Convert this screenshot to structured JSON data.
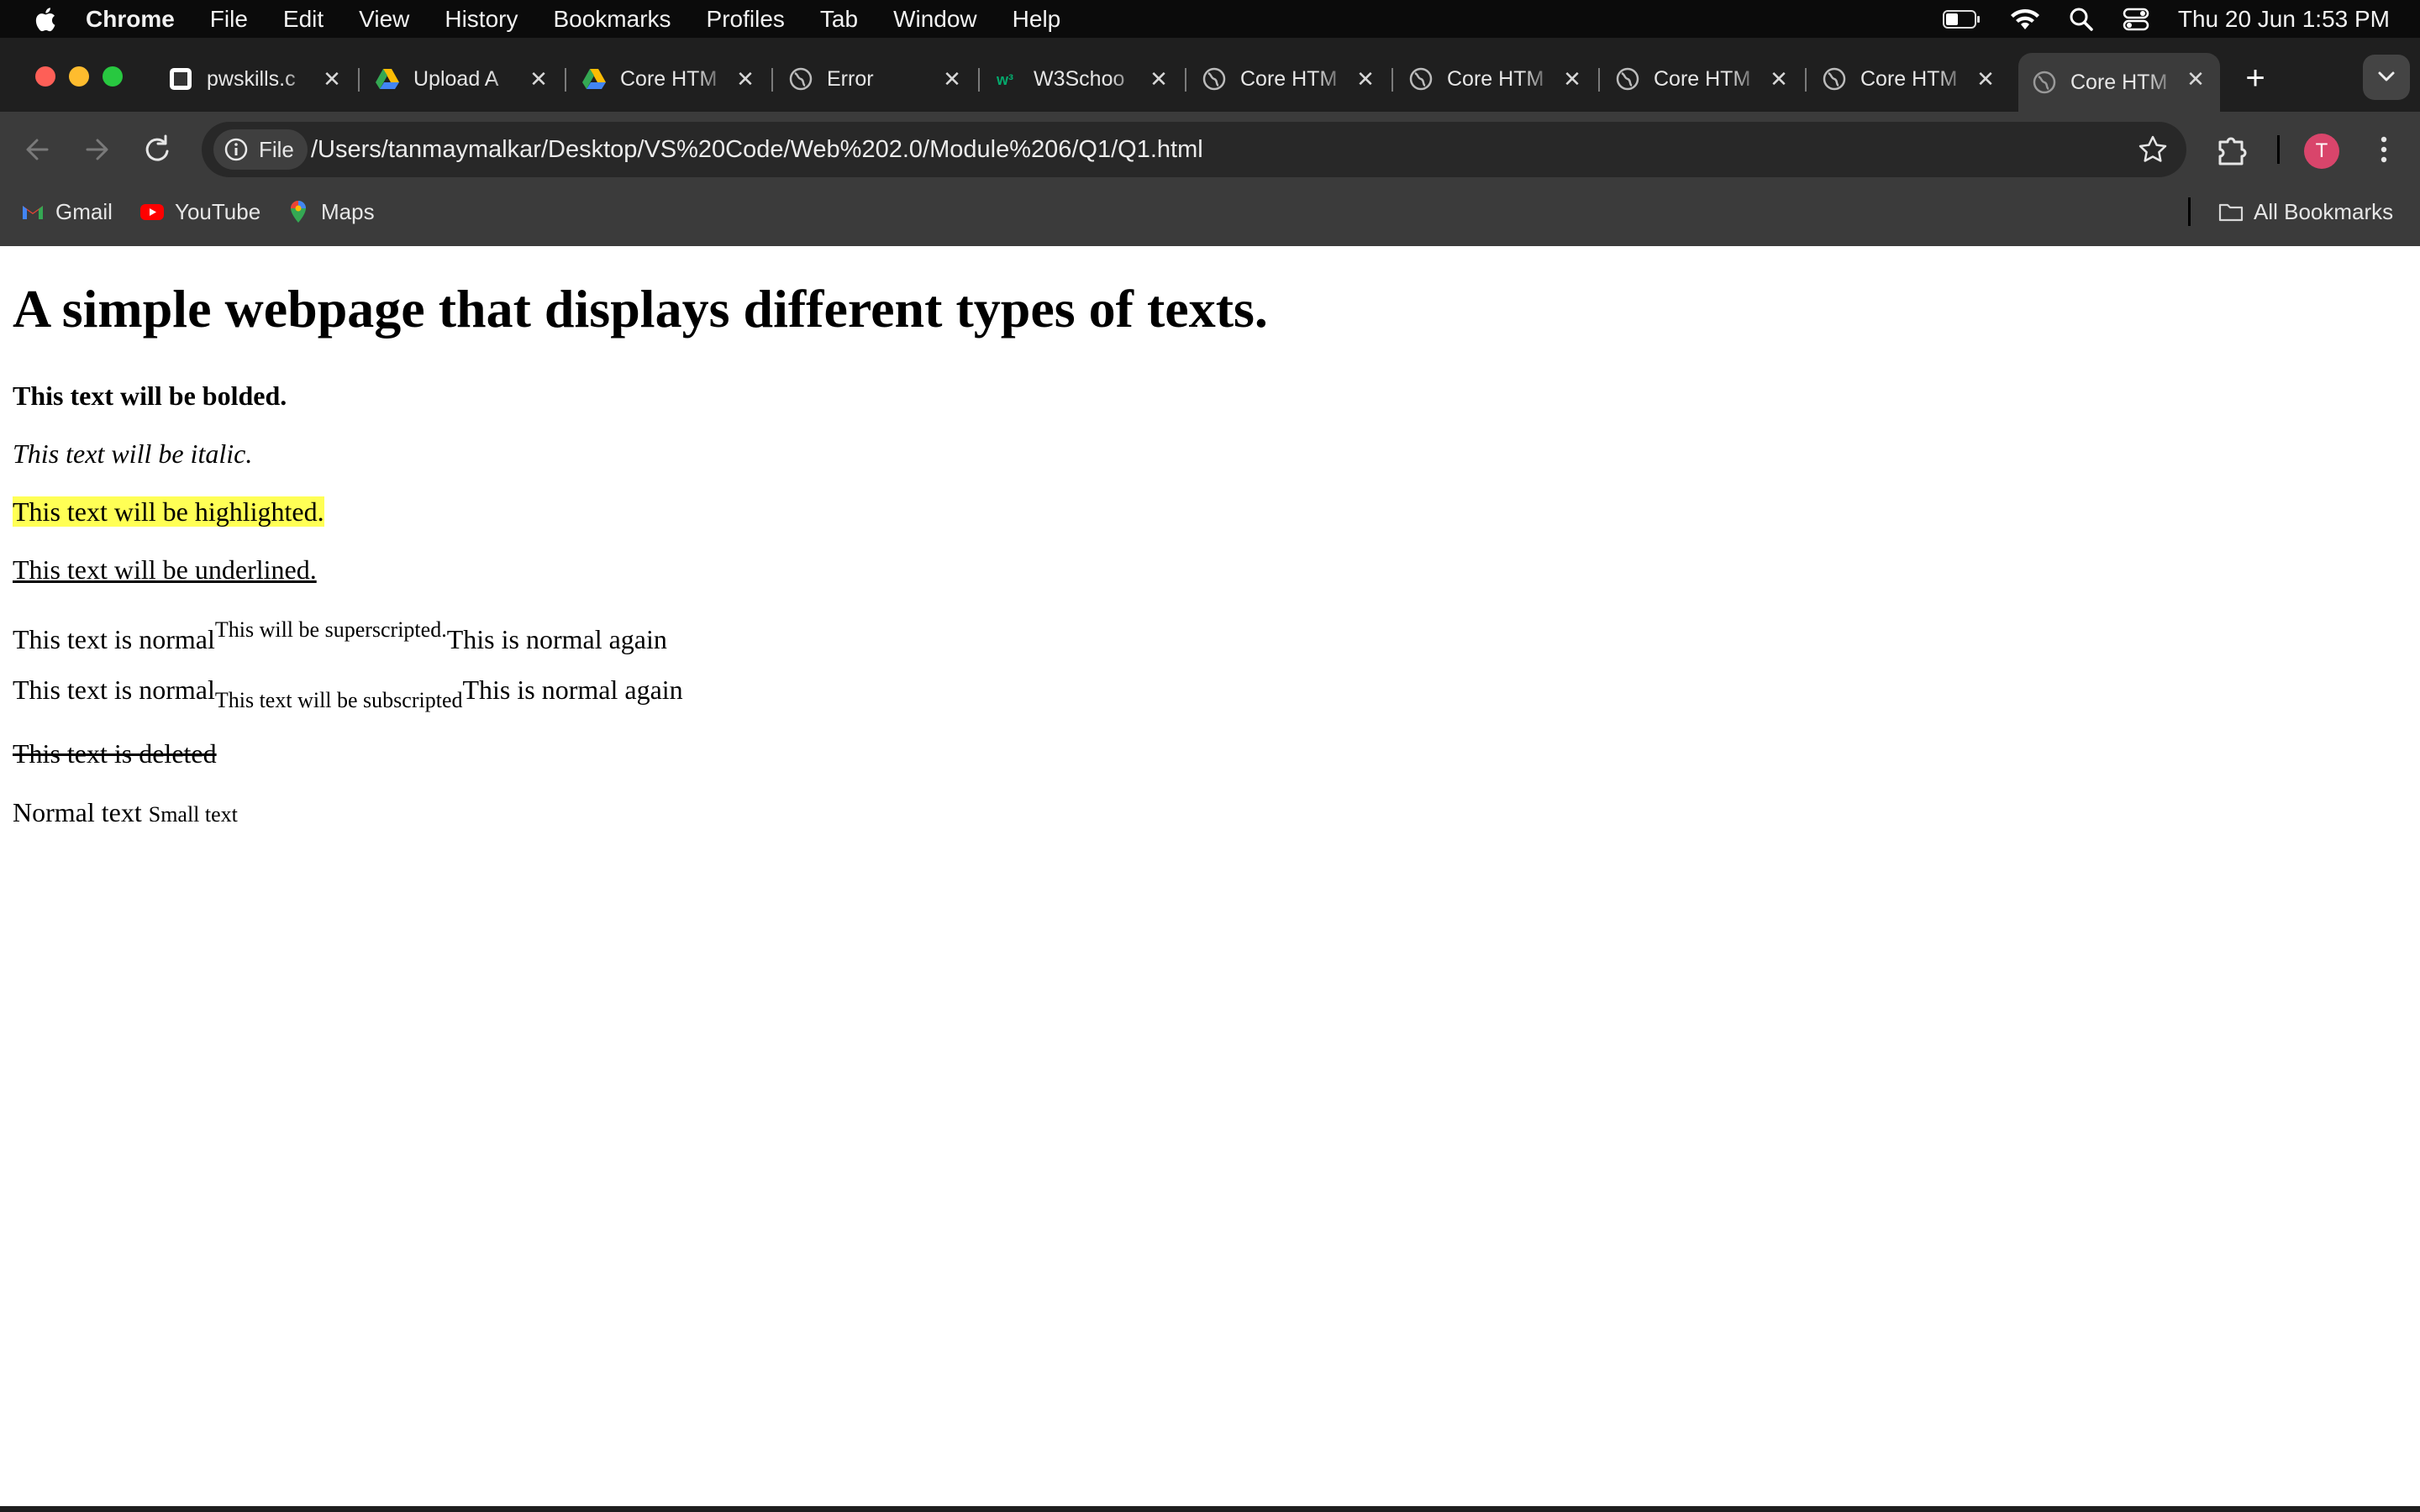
{
  "menubar": {
    "app": "Chrome",
    "items": [
      "File",
      "Edit",
      "View",
      "History",
      "Bookmarks",
      "Profiles",
      "Tab",
      "Window",
      "Help"
    ],
    "clock": "Thu 20 Jun  1:53 PM"
  },
  "tabs": [
    {
      "title": "pwskills.c",
      "icon": "pwskills-icon"
    },
    {
      "title": "Upload A",
      "icon": "drive-icon"
    },
    {
      "title": "Core HTM",
      "icon": "drive-icon"
    },
    {
      "title": "Error",
      "icon": "globe-icon"
    },
    {
      "title": "W3Schoo",
      "icon": "w3schools-icon"
    },
    {
      "title": "Core HTM",
      "icon": "globe-icon"
    },
    {
      "title": "Core HTM",
      "icon": "globe-icon"
    },
    {
      "title": "Core HTM",
      "icon": "globe-icon"
    },
    {
      "title": "Core HTM",
      "icon": "globe-icon"
    },
    {
      "title": "Core HTM",
      "icon": "globe-icon",
      "active": true
    }
  ],
  "toolbar": {
    "chip_label": "File",
    "url": "/Users/tanmaymalkar/Desktop/VS%20Code/Web%202.0/Module%206/Q1/Q1.html",
    "avatar_letter": "T"
  },
  "bookmarks": {
    "items": [
      "Gmail",
      "YouTube",
      "Maps"
    ],
    "all": "All Bookmarks"
  },
  "content": {
    "heading": "A simple webpage that displays different types of texts.",
    "bold": "This text will be bolded.",
    "italic": "This text will be italic.",
    "highlight": "This text will be highlighted.",
    "underline": "This text will be underlined.",
    "sup_normal": "This text is normal",
    "sup_text": "This will be superscripted.",
    "sup_after": "This is normal again",
    "sub_normal": "This text is normal",
    "sub_text": "This text will be subscripted",
    "sub_after": "This is normal again",
    "deleted": "This text is deleted",
    "normal_text": "Normal text",
    "small_text": "Small text"
  },
  "colors": {
    "highlight": "#ffff55",
    "active_tab": "#3b3b3b",
    "avatar": "#d9456b"
  }
}
